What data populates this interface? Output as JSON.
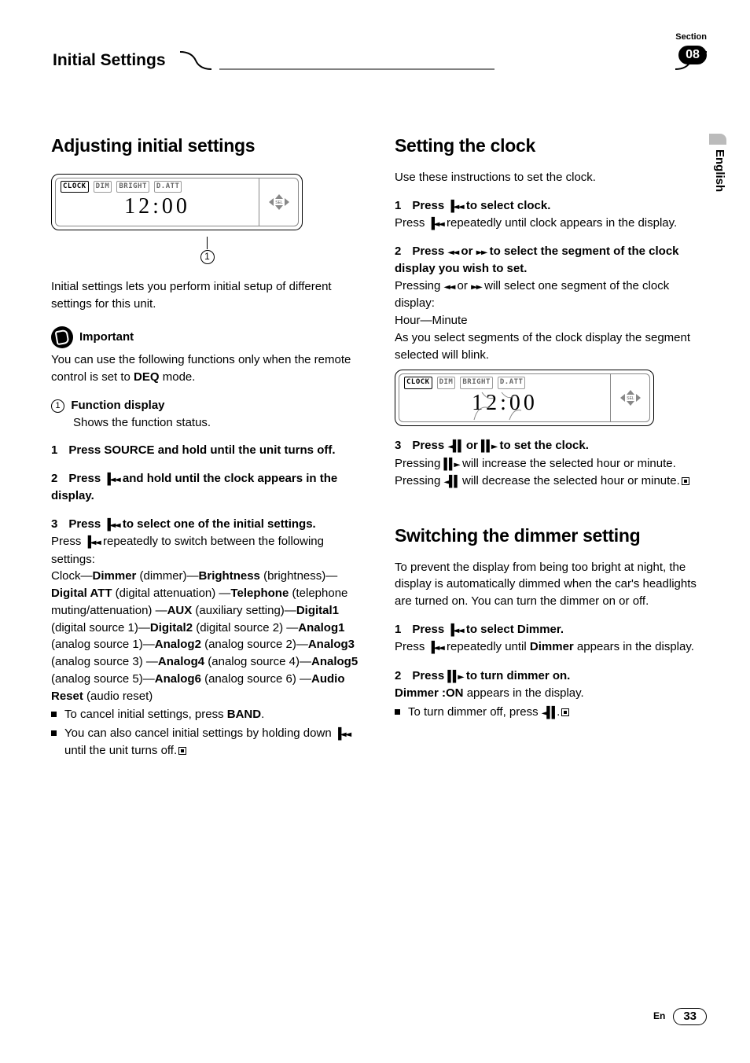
{
  "header": {
    "section_label": "Section",
    "title": "Initial Settings",
    "badge": "08"
  },
  "language_tab": "English",
  "left": {
    "h2": "Adjusting initial settings",
    "display": {
      "labels": {
        "clock": "CLOCK",
        "dim": "DIM",
        "bright": "BRIGHT",
        "datt": "D.ATT"
      },
      "clock": "12:00",
      "sel": "SEL"
    },
    "callout_num": "1",
    "intro": "Initial settings lets you perform initial setup of different settings for this unit.",
    "important_label": "Important",
    "important_text_1": "You can use the following functions only when the remote control is set to ",
    "important_bold": "DEQ",
    "important_text_2": " mode.",
    "fn_num": "1",
    "fn_title": "Function display",
    "fn_desc": "Shows the function status.",
    "step1": {
      "num": "1",
      "text": "Press SOURCE and hold until the unit turns off."
    },
    "step2": {
      "num": "2",
      "text_1": "Press ",
      "text_2": " and hold until the clock appears in the display."
    },
    "step3": {
      "num": "3",
      "text_1": "Press ",
      "text_2": " to select one of the initial settings.",
      "desc_1": "Press ",
      "desc_2": " repeatedly to switch between the following settings:",
      "chain": {
        "t1": "Clock—",
        "b1": "Dimmer",
        "t2": " (dimmer)—",
        "b2": "Brightness",
        "t3": " (brightness)—",
        "b3": "Digital ATT",
        "t4": " (digital attenuation) —",
        "b4": "Telephone",
        "t5": " (telephone muting/attenuation) —",
        "b5": "AUX",
        "t6": " (auxiliary setting)—",
        "b6": "Digital1",
        "t7": " (digital source 1)—",
        "b7": "Digital2",
        "t8": " (digital source 2) —",
        "b8": "Analog1",
        "t9": " (analog source 1)—",
        "b9": "Analog2",
        "t10": " (analog source 2)—",
        "b10": "Analog3",
        "t11": " (analog source 3) —",
        "b11": "Analog4",
        "t12": " (analog source 4)—",
        "b12": "Analog5",
        "t13": " (analog source 5)—",
        "b13": "Analog6",
        "t14": " (analog source 6) —",
        "b14": "Audio Reset",
        "t15": " (audio reset)"
      },
      "bullet1_1": "To cancel initial settings, press ",
      "bullet1_b": "BAND",
      "bullet1_2": ".",
      "bullet2_1": "You can also cancel initial settings by holding down ",
      "bullet2_2": " until the unit turns off."
    }
  },
  "right": {
    "h2a": "Setting the clock",
    "intro": "Use these instructions to set the clock.",
    "step1": {
      "num": "1",
      "head_1": "Press ",
      "head_2": " to select clock.",
      "desc_1": "Press ",
      "desc_2": " repeatedly until clock appears in the display."
    },
    "step2": {
      "num": "2",
      "head_1": "Press ",
      "head_2": " or ",
      "head_3": " to select the segment of the clock display you wish to set.",
      "desc_1": "Pressing ",
      "desc_2": " or ",
      "desc_3": " will select one segment of the clock display:",
      "chain": "Hour—Minute",
      "desc_4": "As you select segments of the clock display the segment selected will blink."
    },
    "display2": {
      "labels": {
        "clock": "CLOCK",
        "dim": "DIM",
        "bright": "BRIGHT",
        "datt": "D.ATT"
      },
      "clock": "12:00",
      "sel": "SEL"
    },
    "step3": {
      "num": "3",
      "head_1": "Press ",
      "head_2": " or ",
      "head_3": " to set the clock.",
      "desc_1": "Pressing ",
      "desc_2": " will increase the selected hour or minute. Pressing ",
      "desc_3": " will decrease the selected hour or minute."
    },
    "h2b": "Switching the dimmer setting",
    "dimmer_intro": "To prevent the display from being too bright at night, the display is automatically dimmed when the car's headlights are turned on. You can turn the dimmer on or off.",
    "dstep1": {
      "num": "1",
      "head_1": "Press ",
      "head_2": " to select Dimmer.",
      "desc_1": "Press ",
      "desc_2": " repeatedly until ",
      "desc_b": "Dimmer",
      "desc_3": " appears in the display."
    },
    "dstep2": {
      "num": "2",
      "head_1": "Press ",
      "head_2": " to turn dimmer on.",
      "desc_b": "Dimmer :ON",
      "desc_1": " appears in the display.",
      "bullet_1": "To turn dimmer off, press ",
      "bullet_2": "."
    }
  },
  "icons": {
    "prev": "▐◄◄",
    "rwd": "◄◄",
    "fwd": "►►",
    "pause_prev": "◄▌▌",
    "pause_next": "▌▌►"
  },
  "footer": {
    "lang": "En",
    "page": "33"
  }
}
